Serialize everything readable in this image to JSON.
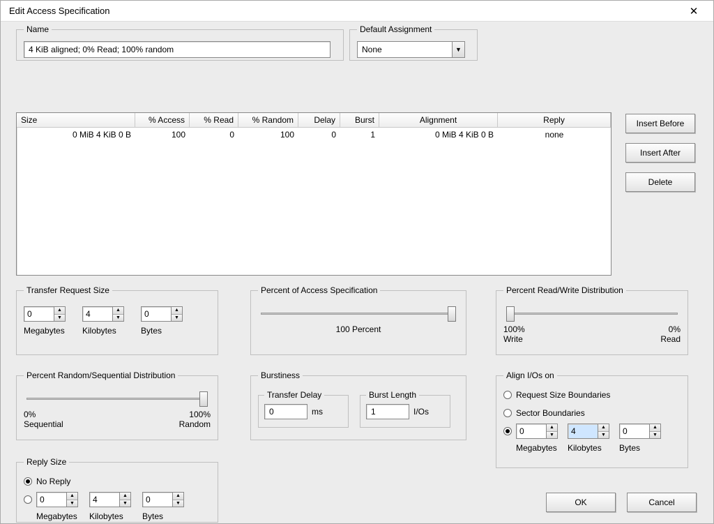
{
  "window": {
    "title": "Edit Access Specification"
  },
  "name_group": {
    "legend": "Name",
    "value": "4 KiB aligned; 0% Read; 100% random"
  },
  "default_assignment": {
    "legend": "Default Assignment",
    "value": "None"
  },
  "list": {
    "headers": {
      "size": "Size",
      "access": "% Access",
      "read": "% Read",
      "random": "% Random",
      "delay": "Delay",
      "burst": "Burst",
      "alignment": "Alignment",
      "reply": "Reply"
    },
    "row": {
      "size": "0 MiB    4 KiB    0 B",
      "access": "100",
      "read": "0",
      "random": "100",
      "delay": "0",
      "burst": "1",
      "alignment": "0 MiB    4 KiB    0 B",
      "reply": "none"
    }
  },
  "side_buttons": {
    "insert_before": "Insert Before",
    "insert_after": "Insert After",
    "delete": "Delete"
  },
  "transfer_request_size": {
    "legend": "Transfer Request Size",
    "mb": "0",
    "kb": "4",
    "b": "0",
    "mb_label": "Megabytes",
    "kb_label": "Kilobytes",
    "b_label": "Bytes"
  },
  "percent_access": {
    "legend": "Percent of Access Specification",
    "caption": "100 Percent"
  },
  "rw_dist": {
    "legend": "Percent Read/Write Distribution",
    "left_top": "100%",
    "left_bot": "Write",
    "right_top": "0%",
    "right_bot": "Read"
  },
  "rand_seq": {
    "legend": "Percent Random/Sequential Distribution",
    "left_top": "0%",
    "left_bot": "Sequential",
    "right_top": "100%",
    "right_bot": "Random"
  },
  "burstiness": {
    "legend": "Burstiness",
    "td_legend": "Transfer Delay",
    "td_value": "0",
    "td_unit": "ms",
    "bl_legend": "Burst Length",
    "bl_value": "1",
    "bl_unit": "I/Os"
  },
  "align": {
    "legend": "Align I/Os on",
    "opt1": "Request Size Boundaries",
    "opt2": "Sector Boundaries",
    "mb": "0",
    "kb": "4",
    "b": "0",
    "mb_label": "Megabytes",
    "kb_label": "Kilobytes",
    "b_label": "Bytes"
  },
  "reply_size": {
    "legend": "Reply Size",
    "no_reply": "No Reply",
    "mb": "0",
    "kb": "4",
    "b": "0",
    "mb_label": "Megabytes",
    "kb_label": "Kilobytes",
    "b_label": "Bytes"
  },
  "footer": {
    "ok": "OK",
    "cancel": "Cancel"
  }
}
